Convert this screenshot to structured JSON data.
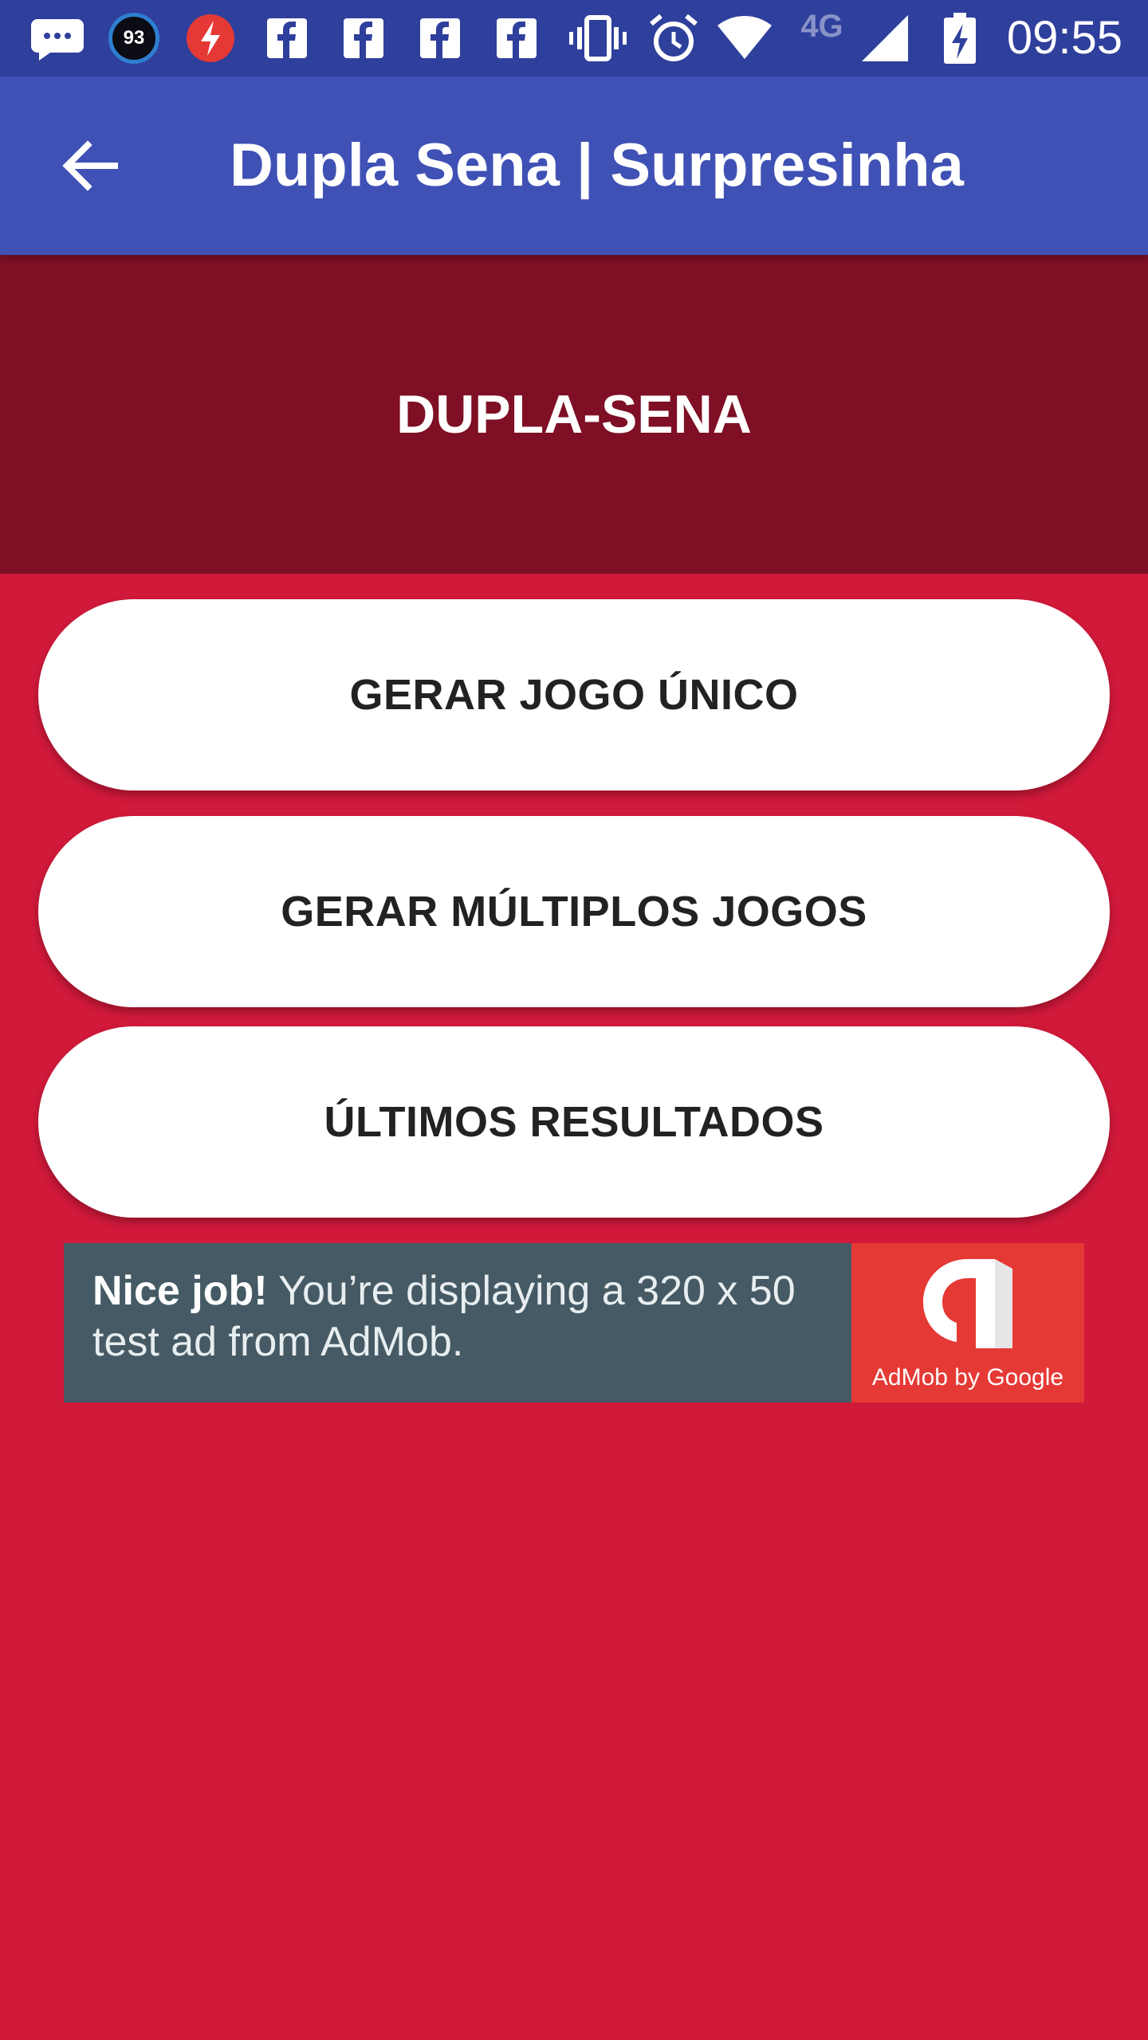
{
  "status_bar": {
    "time": "09:55",
    "notification_count": "93",
    "network_label": "4G",
    "icons": [
      "chat-bubble-icon",
      "battery-saver-93-icon",
      "flash-app-icon",
      "facebook-icon",
      "facebook-icon",
      "facebook-icon",
      "facebook-icon",
      "vibrate-icon",
      "alarm-icon",
      "wifi-icon",
      "signal-icon",
      "battery-charging-icon"
    ]
  },
  "app_bar": {
    "title": "Dupla Sena | Surpresinha",
    "back_icon": "arrow-back-icon",
    "color": "#3F51B5"
  },
  "header": {
    "title": "DUPLA-SENA",
    "color": "#7E0F24"
  },
  "buttons": {
    "single_game": "GERAR JOGO ÚNICO",
    "multiple_games": "GERAR MÚLTIPLOS JOGOS",
    "last_results": "ÚLTIMOS RESULTADOS"
  },
  "ad": {
    "bold_text": "Nice job!",
    "text": "You’re displaying a 320 x 50 test ad from AdMob.",
    "brand": "AdMob by Google"
  },
  "colors": {
    "background": "#D1193A",
    "status_bar": "#2F3F9C",
    "ad_background": "#455A64",
    "ad_brand": "#E53935"
  }
}
